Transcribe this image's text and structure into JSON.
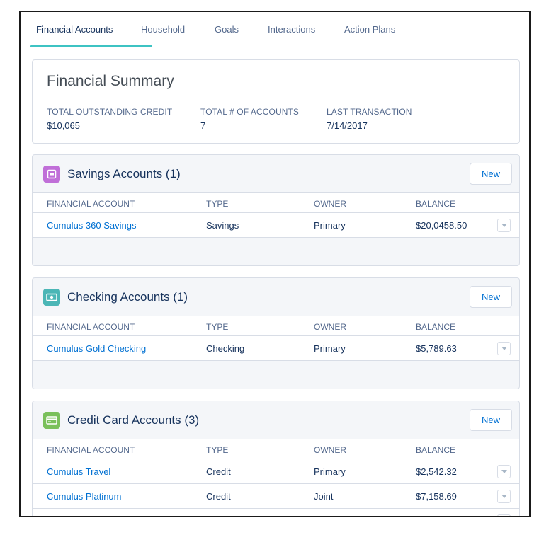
{
  "tabs": [
    {
      "label": "Financial Accounts"
    },
    {
      "label": "Household"
    },
    {
      "label": "Goals"
    },
    {
      "label": "Interactions"
    },
    {
      "label": "Action Plans"
    }
  ],
  "summary": {
    "title": "Financial Summary",
    "fields": [
      {
        "label": "TOTAL OUTSTANDING CREDIT",
        "value": "$10,065"
      },
      {
        "label": "TOTAL # OF ACCOUNTS",
        "value": "7"
      },
      {
        "label": "LAST TRANSACTION",
        "value": "7/14/2017"
      }
    ]
  },
  "columns": {
    "account": "FINANCIAL ACCOUNT",
    "type": "TYPE",
    "owner": "OWNER",
    "balance": "BALANCE"
  },
  "new_label": "New",
  "sections": [
    {
      "title": "Savings Accounts (1)",
      "icon": "savings-icon",
      "color": "#c06fd8",
      "rows": [
        {
          "account": "Cumulus 360 Savings",
          "type": "Savings",
          "owner": "Primary",
          "balance": "$20,0458.50"
        }
      ]
    },
    {
      "title": "Checking Accounts (1)",
      "icon": "checking-icon",
      "color": "#4bb6b6",
      "rows": [
        {
          "account": "Cumulus Gold Checking",
          "type": "Checking",
          "owner": "Primary",
          "balance": "$5,789.63"
        }
      ]
    },
    {
      "title": "Credit Card Accounts (3)",
      "icon": "credit-card-icon",
      "color": "#7ac05b",
      "rows": [
        {
          "account": "Cumulus Travel",
          "type": "Credit",
          "owner": "Primary",
          "balance": "$2,542.32"
        },
        {
          "account": "Cumulus Platinum",
          "type": "Credit",
          "owner": "Joint",
          "balance": "$7,158.69"
        }
      ]
    }
  ]
}
